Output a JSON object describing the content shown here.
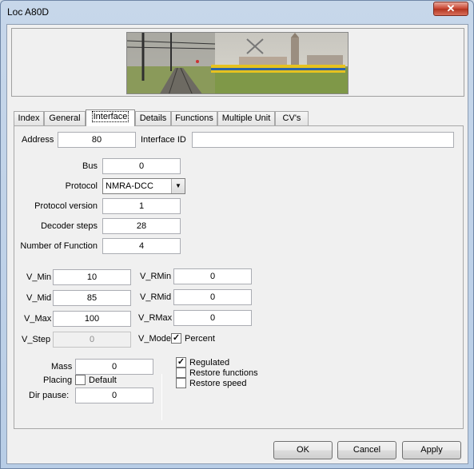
{
  "window": {
    "title": "Loc A80D",
    "close_glyph": "✕"
  },
  "banner": {
    "description_icon": "railway-photo"
  },
  "tabs": [
    {
      "label": "Index"
    },
    {
      "label": "General"
    },
    {
      "label": "Interface"
    },
    {
      "label": "Details"
    },
    {
      "label": "Functions"
    },
    {
      "label": "Multiple Unit"
    },
    {
      "label": "CV's"
    }
  ],
  "interface": {
    "address_label": "Address",
    "address_value": "80",
    "interface_id_label": "Interface ID",
    "interface_id_value": "",
    "bus_label": "Bus",
    "bus_value": "0",
    "protocol_label": "Protocol",
    "protocol_value": "NMRA-DCC",
    "protocol_version_label": "Protocol version",
    "protocol_version_value": "1",
    "decoder_steps_label": "Decoder steps",
    "decoder_steps_value": "28",
    "num_function_label": "Number of Function",
    "num_function_value": "4",
    "vmin_label": "V_Min",
    "vmin_value": "10",
    "vmid_label": "V_Mid",
    "vmid_value": "85",
    "vmax_label": "V_Max",
    "vmax_value": "100",
    "vstep_label": "V_Step",
    "vstep_value": "0",
    "vrmin_label": "V_RMin",
    "vrmin_value": "0",
    "vrmid_label": "V_RMid",
    "vrmid_value": "0",
    "vrmax_label": "V_RMax",
    "vrmax_value": "0",
    "vmode_label": "V_Mode",
    "percent_label": "Percent",
    "percent_checked": true,
    "mass_label": "Mass",
    "mass_value": "0",
    "placing_label": "Placing",
    "default_label": "Default",
    "default_checked": false,
    "dir_pause_label": "Dir pause:",
    "dir_pause_value": "0",
    "regulated_label": "Regulated",
    "regulated_checked": true,
    "restore_functions_label": "Restore functions",
    "restore_functions_checked": false,
    "restore_speed_label": "Restore speed",
    "restore_speed_checked": false
  },
  "buttons": {
    "ok": "OK",
    "cancel": "Cancel",
    "apply": "Apply"
  },
  "check_glyph": "✓"
}
